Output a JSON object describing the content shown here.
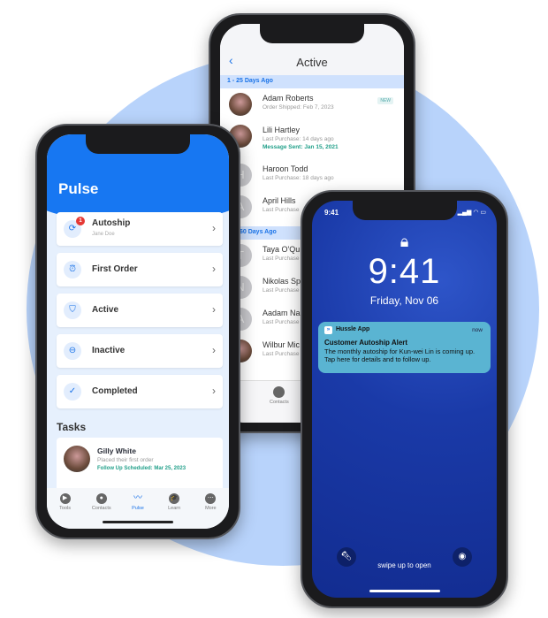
{
  "middle_phone": {
    "title": "Active",
    "back_icon": "chevron-left-icon",
    "section1": "1 - 25 Days Ago",
    "section2": "31 - 60 Days Ago",
    "rows1": [
      {
        "name": "Adam Roberts",
        "sub": "Order Shipped: Feb 7, 2023",
        "badge": "NEW"
      },
      {
        "name": "Lili Hartley",
        "sub": "Last Purchase: 14 days ago",
        "msg": "Message Sent: Jan 15, 2021"
      },
      {
        "name": "Haroon Todd",
        "sub": "Last Purchase: 18 days ago",
        "initial": "H"
      },
      {
        "name": "April Hills",
        "sub": "Last Purchase",
        "initial": "A"
      }
    ],
    "rows2": [
      {
        "name": "Taya O'Qu",
        "sub": "Last Purchase",
        "initial": "T"
      },
      {
        "name": "Nikolas Sp",
        "sub": "Last Purchase",
        "initial": "N"
      },
      {
        "name": "Aadam Na",
        "sub": "Last Purchase",
        "initial": "A"
      },
      {
        "name": "Wilbur Mic",
        "sub": "Last Purchase"
      }
    ],
    "tab_contacts": "Contacts"
  },
  "left_phone": {
    "title": "Pulse",
    "cards": [
      {
        "label": "Autoship",
        "sub": "Jane Doe",
        "badge": "1",
        "icon": "refresh-icon"
      },
      {
        "label": "First Order",
        "icon": "alarm-icon"
      },
      {
        "label": "Active",
        "icon": "shield-icon"
      },
      {
        "label": "Inactive",
        "icon": "minus-circle-icon"
      },
      {
        "label": "Completed",
        "icon": "check-circle-icon"
      }
    ],
    "tasks_heading": "Tasks",
    "task": {
      "name": "Gilly White",
      "sub": "Placed their first order",
      "scheduled": "Follow Up Scheduled: Mar 25, 2023"
    },
    "tabs": [
      {
        "label": "Tools",
        "glyph": "▶"
      },
      {
        "label": "Contacts",
        "glyph": "●"
      },
      {
        "label": "Pulse",
        "glyph": "〰",
        "active": true
      },
      {
        "label": "Learn",
        "glyph": "🎓"
      },
      {
        "label": "More",
        "glyph": "⋯"
      }
    ]
  },
  "right_phone": {
    "status_time": "9:41",
    "clock": "9:41",
    "date": "Friday, Nov 06",
    "notification": {
      "app": "Hussle App",
      "time": "now",
      "title": "Customer Autoship Alert",
      "body": "The monthly autoship for Kun-wei Lin is coming up. Tap here for details and to follow up."
    },
    "swipe": "swipe up to open"
  },
  "colors": {
    "primary": "#1777f2",
    "background_circle": "#b8d3fb",
    "success": "#22a08a",
    "badge": "#e53935",
    "notification": "#5ab4d2"
  }
}
